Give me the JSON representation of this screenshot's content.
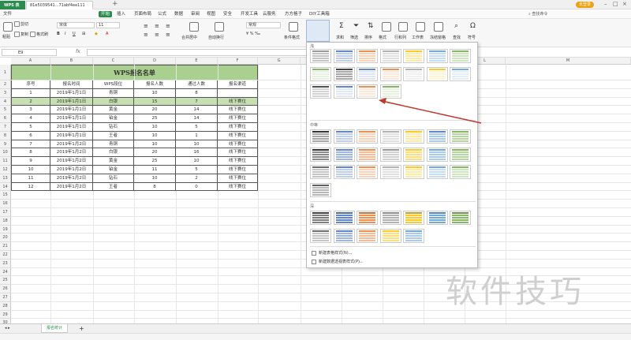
{
  "titlebar": {
    "app_tab": "WPS 表格",
    "file_tab": "81e5039541...71abf4ee111",
    "login_label": "未登录"
  },
  "menu": {
    "file": "文件",
    "items": [
      "开始",
      "插入",
      "页面布局",
      "公式",
      "数据",
      "审阅",
      "视图",
      "安全",
      "开发工具",
      "云服务",
      "方方格子",
      "DIY工具箱"
    ],
    "search_label": "查找命令"
  },
  "ribbon": {
    "cut": "剪切",
    "paste": "粘贴",
    "copy": "复制",
    "format_painter": "格式刷",
    "font_name": "宋体",
    "font_size": "11",
    "merge_center": "合并居中",
    "wrap_text": "自动换行",
    "number_format": "常规",
    "conditional_format": "条件格式",
    "table_style": "表格样式",
    "sum": "求和",
    "filter": "筛选",
    "sort": "排序",
    "format": "格式",
    "row_col": "行和列",
    "worksheet": "工作表",
    "freeze": "冻结窗格",
    "find": "查找",
    "symbol": "符号"
  },
  "formula_bar": {
    "cell_ref": "E9",
    "fx": "fx"
  },
  "sheet": {
    "columns": [
      "A",
      "B",
      "C",
      "D",
      "E",
      "F",
      "G",
      "H",
      "I",
      "J",
      "K",
      "L",
      "M"
    ],
    "row_numbers": [
      "1",
      "2",
      "3",
      "4",
      "5",
      "6",
      "7",
      "8",
      "9",
      "10",
      "11",
      "12",
      "13",
      "14",
      "15",
      "16",
      "17",
      "18",
      "19",
      "20",
      "21",
      "22",
      "23",
      "24",
      "25",
      "26",
      "27",
      "28",
      "29",
      "30"
    ],
    "title": "WPS报名名单",
    "headers": [
      "序号",
      "报名时间",
      "WPS段位",
      "报名人数",
      "通过人数",
      "报名渠道"
    ],
    "rows": [
      [
        "1",
        "2019年1月1日",
        "青铜",
        "10",
        "8",
        ""
      ],
      [
        "2",
        "2019年1月1日",
        "白银",
        "15",
        "7",
        "线下赛位"
      ],
      [
        "3",
        "2019年1月1日",
        "黄金",
        "20",
        "14",
        "线下赛位"
      ],
      [
        "4",
        "2019年1月1日",
        "铂金",
        "25",
        "14",
        "线下赛位"
      ],
      [
        "5",
        "2019年1月1日",
        "钻石",
        "10",
        "5",
        "线下赛位"
      ],
      [
        "6",
        "2019年1月1日",
        "王者",
        "10",
        "1",
        "线下赛位"
      ],
      [
        "7",
        "2019年1月2日",
        "青铜",
        "10",
        "10",
        "线下赛位"
      ],
      [
        "8",
        "2019年1月2日",
        "白银",
        "20",
        "16",
        "线下赛位"
      ],
      [
        "9",
        "2019年1月2日",
        "黄金",
        "25",
        "10",
        "线下赛位"
      ],
      [
        "10",
        "2019年1月2日",
        "铂金",
        "11",
        "5",
        "线下赛位"
      ],
      [
        "11",
        "2019年1月2日",
        "钻石",
        "10",
        "2",
        "线下赛位"
      ],
      [
        "12",
        "2019年1月2日",
        "王者",
        "8",
        "0",
        "线下赛位"
      ]
    ],
    "tab_name": "报名统计"
  },
  "dropdown": {
    "light_label": "浅",
    "medium_label": "中等",
    "dark_label": "深",
    "new_table_style": "新建表格样式(N)...",
    "new_pivot_style": "新建数据透视表样式(P)..."
  },
  "colors": {
    "accent": "#2b8c4e",
    "title_fill": "#a9d08e",
    "arrow": "#c0392b"
  },
  "watermark": "软件技巧"
}
